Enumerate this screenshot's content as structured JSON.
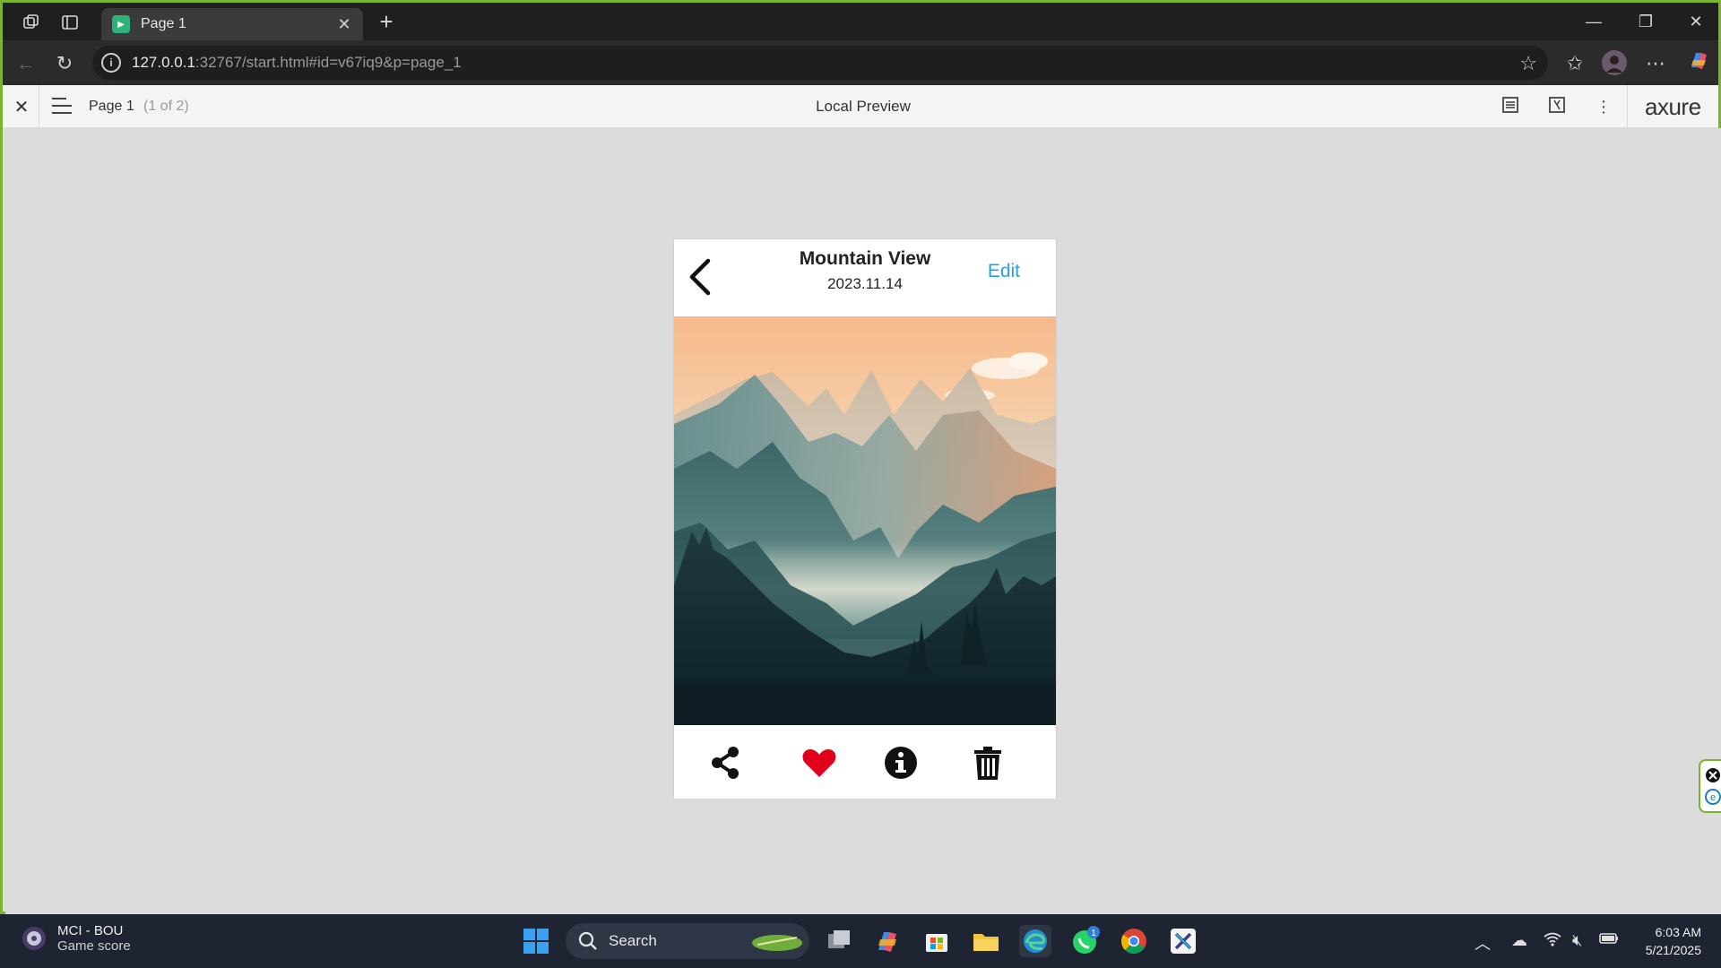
{
  "browser": {
    "tab_title": "Page 1",
    "url_host": "127.0.0.1",
    "url_rest": ":32767/start.html#id=v67iq9&p=page_1"
  },
  "axure": {
    "page_name": "Page 1",
    "page_count": "(1 of 2)",
    "preview_title": "Local Preview",
    "logo": "axure"
  },
  "phone": {
    "title": "Mountain View",
    "date": "2023.11.14",
    "edit_label": "Edit",
    "actions": [
      "share-icon",
      "heart-icon",
      "info-icon",
      "trash-icon"
    ],
    "heart_color": "#e0001b",
    "edit_color": "#2a9fd6"
  },
  "taskbar": {
    "weather_line1": "MCI - BOU",
    "weather_line2": "Game score",
    "search_label": "Search",
    "badge_count": "1",
    "time": "6:03 AM",
    "date": "5/21/2025"
  }
}
